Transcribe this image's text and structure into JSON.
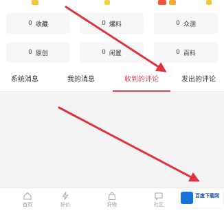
{
  "stats": [
    {
      "count": "0",
      "label": "收藏"
    },
    {
      "count": "0",
      "label": "爆料"
    },
    {
      "count": "0",
      "label": "众测"
    },
    {
      "count": "0",
      "label": "原创"
    },
    {
      "count": "0",
      "label": "闲置"
    },
    {
      "count": "0",
      "label": "百科"
    }
  ],
  "tabs": [
    {
      "label": "系统消息"
    },
    {
      "label": "我的消息"
    },
    {
      "label": "收到的评论"
    },
    {
      "label": "发出的评论"
    }
  ],
  "active_tab": "收到的评论",
  "bottom_nav": [
    {
      "label": "首页",
      "icon": "home-icon"
    },
    {
      "label": "好价",
      "icon": "lightning-icon"
    },
    {
      "label": "好物",
      "icon": "bag-icon"
    },
    {
      "label": "社区",
      "icon": "chat-icon"
    }
  ],
  "watermark": {
    "name": "百度下载网"
  },
  "colors": {
    "accent": "#e2424d",
    "annotation_arrow": "#e0333f"
  }
}
